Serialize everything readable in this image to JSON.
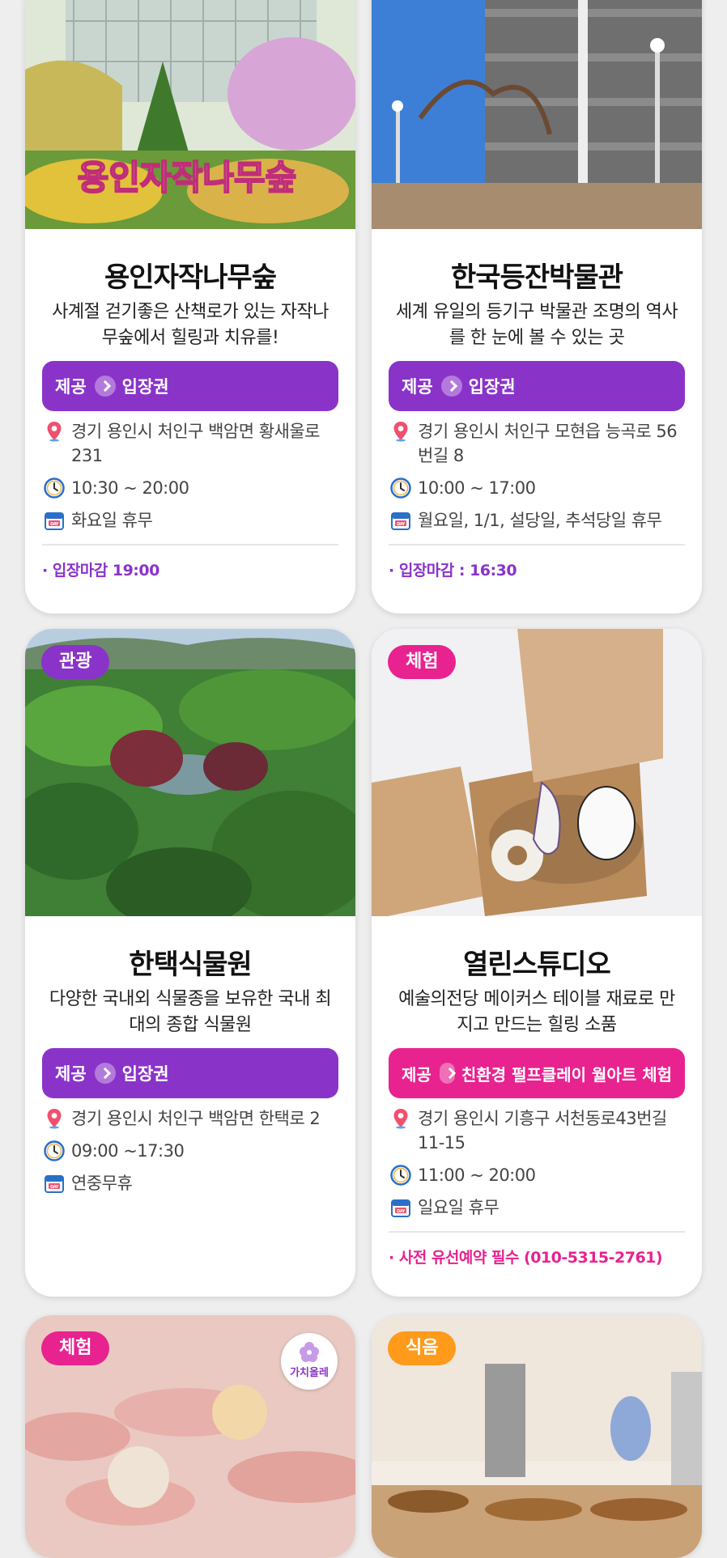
{
  "cards": [
    {
      "title": "용인자작나무숲",
      "desc": "사계절 걷기좋은 산책로가 있는 자작나무숲에서 힐링과 치유를!",
      "photo_text": "용인자작나무숲",
      "offer_label": "제공",
      "offer_item": "입장권",
      "address": "경기 용인시 처인구 백암면 황새울로 231",
      "hours": "10:30 ~ 20:00",
      "closed": "화요일 휴무",
      "note": "· 입장마감 19:00"
    },
    {
      "title": "한국등잔박물관",
      "desc": "세계 유일의 등기구 박물관 조명의 역사를 한 눈에 볼 수 있는 곳",
      "offer_label": "제공",
      "offer_item": "입장권",
      "address": "경기 용인시 처인구 모현읍 능곡로 56번길 8",
      "hours": "10:00 ~ 17:00",
      "closed": "월요일, 1/1, 설당일, 추석당일 휴무",
      "note": "· 입장마감 : 16:30"
    },
    {
      "badge": "관광",
      "title": "한택식물원",
      "desc": "다양한 국내외 식물종을 보유한 국내 최대의 종합 식물원",
      "offer_label": "제공",
      "offer_item": "입장권",
      "address": "경기 용인시 처인구 백암면 한택로 2",
      "hours": "09:00 ~17:30",
      "closed": "연중무휴"
    },
    {
      "badge": "체험",
      "title": "열린스튜디오",
      "desc": "예술의전당 메이커스 테이블 재료로 만지고 만드는 힐링 소품",
      "offer_label": "제공",
      "offer_item": "친환경 펄프클레이 월아트 체험",
      "address": "경기 용인시 기흥구 서천동로43번길 11-15",
      "hours": "11:00 ~ 20:00",
      "closed": "일요일 휴무",
      "note": "· 사전 유선예약 필수 (010-5315-2761)"
    },
    {
      "badge": "체험",
      "stamp": "가치올레"
    },
    {
      "badge": "식음"
    }
  ],
  "colors": {
    "purple": "#8a33c9",
    "pink": "#e8228f",
    "orange": "#ff9a1a"
  },
  "icons": [
    "location-pin-icon",
    "clock-icon",
    "calendar-icon",
    "chevron-right-icon",
    "flower-icon"
  ]
}
